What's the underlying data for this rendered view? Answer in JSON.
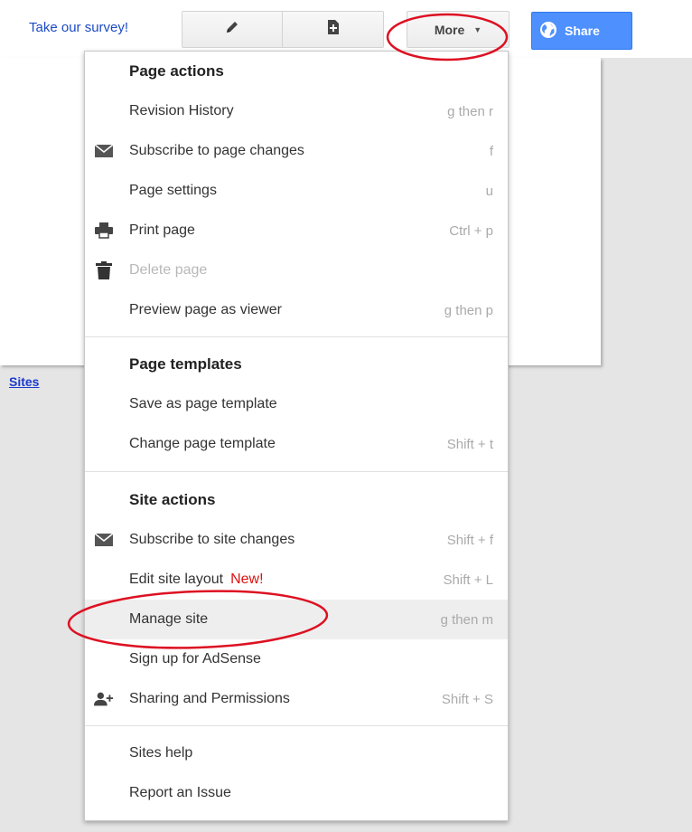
{
  "toolbar": {
    "survey_link": "Take our survey!",
    "more_label": "More",
    "share_label": "Share"
  },
  "page": {
    "sites_link": "Sites"
  },
  "menu": {
    "page_actions_header": "Page actions",
    "revision_history": {
      "label": "Revision History",
      "shortcut": "g then r"
    },
    "subscribe_page": {
      "label": "Subscribe to page changes",
      "shortcut": "f"
    },
    "page_settings": {
      "label": "Page settings",
      "shortcut": "u"
    },
    "print_page": {
      "label": "Print page",
      "shortcut": "Ctrl + p"
    },
    "delete_page": {
      "label": "Delete page"
    },
    "preview_page": {
      "label": "Preview page as viewer",
      "shortcut": "g then p"
    },
    "page_templates_header": "Page templates",
    "save_template": {
      "label": "Save as page template"
    },
    "change_template": {
      "label": "Change page template",
      "shortcut": "Shift + t"
    },
    "site_actions_header": "Site actions",
    "subscribe_site": {
      "label": "Subscribe to site changes",
      "shortcut": "Shift + f"
    },
    "edit_layout": {
      "label": "Edit site layout",
      "badge": "New!",
      "shortcut": "Shift + L"
    },
    "manage_site": {
      "label": "Manage site",
      "shortcut": "g then m"
    },
    "adsense": {
      "label": "Sign up for AdSense"
    },
    "sharing": {
      "label": "Sharing and Permissions",
      "shortcut": "Shift + S"
    },
    "sites_help": {
      "label": "Sites help"
    },
    "report_issue": {
      "label": "Report an Issue"
    }
  },
  "colors": {
    "annotation_red": "#dd1122",
    "share_blue": "#4d90fe",
    "link_blue": "#1c4bc4"
  },
  "icons": [
    "pencil-icon",
    "new-page-icon",
    "caret-down-icon",
    "globe-icon",
    "envelope-icon",
    "printer-icon",
    "trash-icon",
    "add-person-icon"
  ]
}
